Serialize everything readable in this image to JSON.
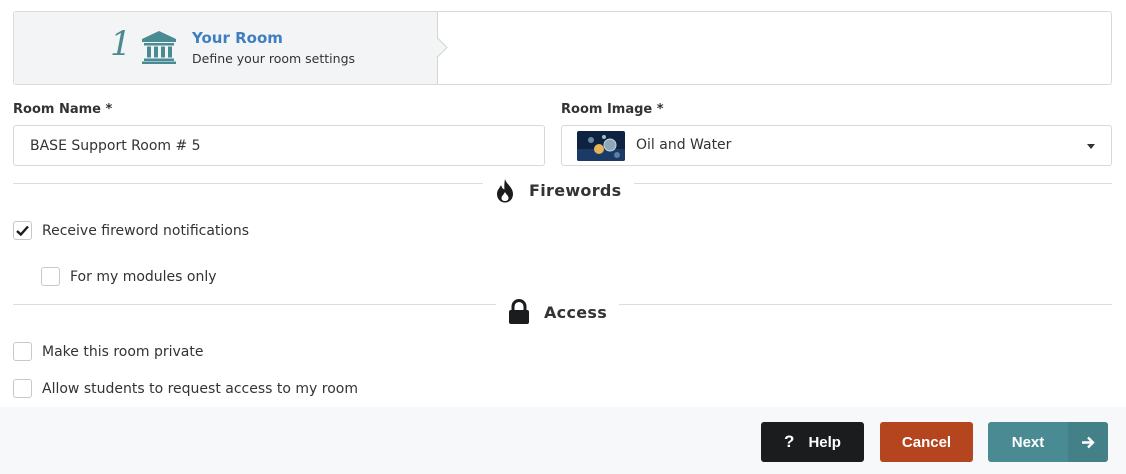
{
  "steps": {
    "active": {
      "number": "1",
      "title": "Your Room",
      "description": "Define your room settings",
      "icon": "bank-icon"
    }
  },
  "form": {
    "room_name": {
      "label": "Room Name *",
      "value": "BASE Support Room # 5"
    },
    "room_image": {
      "label": "Room Image *",
      "selected": "Oil and Water"
    }
  },
  "fireworks": {
    "heading": "Firewords",
    "icon": "fire-icon",
    "receive": {
      "label": "Receive fireword notifications",
      "checked": true
    },
    "modules_only": {
      "label": "For my modules only",
      "checked": false
    }
  },
  "access": {
    "heading": "Access",
    "icon": "lock-icon",
    "private": {
      "label": "Make this room private",
      "checked": false
    },
    "request": {
      "label": "Allow students to request access to my room",
      "checked": false
    }
  },
  "footer": {
    "help_label": "Help",
    "cancel_label": "Cancel",
    "next_label": "Next"
  },
  "colors": {
    "accent": "#4a8a93",
    "title_blue": "#3f7fc0",
    "cancel": "#b5451f",
    "help": "#1b1c1d"
  }
}
